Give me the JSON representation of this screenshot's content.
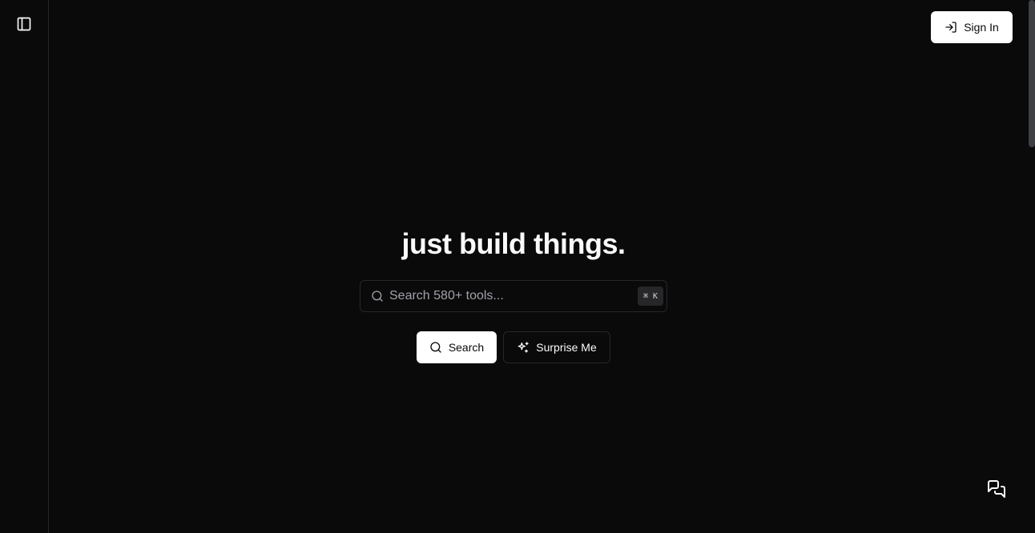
{
  "header": {
    "signin_label": "Sign In"
  },
  "hero": {
    "title": "just build things."
  },
  "search": {
    "placeholder": "Search 580+ tools...",
    "value": "",
    "shortcut": "⌘ K"
  },
  "actions": {
    "search_label": "Search",
    "surprise_label": "Surprise Me"
  },
  "icons": {
    "sidebar_toggle": "panel-left-icon",
    "signin": "log-in-icon",
    "search": "search-icon",
    "surprise": "sparkles-icon",
    "feedback": "messages-square-icon"
  },
  "colors": {
    "background": "#0a0a0a",
    "foreground": "#fafafa",
    "border": "#27272a",
    "muted": "#a1a1aa",
    "primary_button": "#ffffff"
  }
}
